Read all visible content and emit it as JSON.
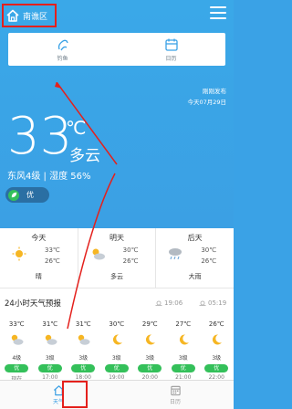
{
  "header": {
    "location": "南谯区",
    "menu_icon": "hamburger-icon"
  },
  "shortcuts": [
    {
      "label": "钓鱼",
      "icon": "fishing-icon"
    },
    {
      "label": "日历",
      "icon": "calendar-icon"
    }
  ],
  "publish": {
    "line1": "刚刚发布",
    "line2": "今天07月29日"
  },
  "current": {
    "temp": "33",
    "unit": "℃",
    "condition": "多云",
    "wind_humidity": "东风4级 | 湿度 56%",
    "aqi": "优"
  },
  "daily": [
    {
      "name": "今天",
      "high": "33℃",
      "low": "26℃",
      "desc": "晴",
      "icon": "sunny-icon"
    },
    {
      "name": "明天",
      "high": "30℃",
      "low": "26℃",
      "desc": "多云",
      "icon": "partly-cloudy-icon"
    },
    {
      "name": "后天",
      "high": "30℃",
      "low": "26℃",
      "desc": "大雨",
      "icon": "heavy-rain-icon"
    }
  ],
  "hourly": {
    "title": "24小时天气预报",
    "sunrise": "19:06",
    "sunset": "05:19",
    "items": [
      {
        "temp": "33℃",
        "wind": "4级",
        "aqi": "优",
        "time": "现在",
        "icon": "partly-cloudy-icon"
      },
      {
        "temp": "31℃",
        "wind": "3级",
        "aqi": "优",
        "time": "17:00",
        "icon": "partly-cloudy-icon"
      },
      {
        "temp": "31℃",
        "wind": "3级",
        "aqi": "优",
        "time": "18:00",
        "icon": "partly-cloudy-icon"
      },
      {
        "temp": "30℃",
        "wind": "3级",
        "aqi": "优",
        "time": "19:00",
        "icon": "moon-icon"
      },
      {
        "temp": "29℃",
        "wind": "3级",
        "aqi": "优",
        "time": "20:00",
        "icon": "moon-icon"
      },
      {
        "temp": "27℃",
        "wind": "3级",
        "aqi": "优",
        "time": "21:00",
        "icon": "moon-icon"
      },
      {
        "temp": "26℃",
        "wind": "3级",
        "aqi": "优",
        "time": "22:00",
        "icon": "moon-icon"
      }
    ]
  },
  "tabs": [
    {
      "label": "天气",
      "icon": "weather-home-icon",
      "active": true
    },
    {
      "label": "日历",
      "icon": "calendar-icon",
      "active": false
    }
  ],
  "colors": {
    "sky": "#3aa2e6",
    "aqi_good": "#34c05a",
    "highlight": "#e4201c",
    "active_tab": "#3a9fe4"
  }
}
